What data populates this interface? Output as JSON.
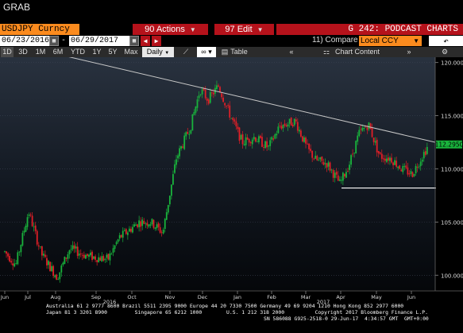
{
  "app": {
    "title": "GRAB"
  },
  "header": {
    "ticker": "USDJPY Curncy",
    "actions": "90 Actions",
    "edit": "97 Edit",
    "chart_id": "G 242: PODCAST CHARTS"
  },
  "range": {
    "start": "06/23/2016",
    "separator": "-",
    "end": "06/29/2017",
    "compare_label": "11) Compare",
    "compare_value": "Local CCY"
  },
  "toolbar": {
    "periods": [
      "1D",
      "3D",
      "1M",
      "6M",
      "YTD",
      "1Y",
      "5Y",
      "Max"
    ],
    "frequency": "Daily",
    "table": "Table",
    "chart_content": "Chart Content"
  },
  "footer": {
    "line1": "Australia 61 2 9777 8600 Brazil 5511 2395 9000 Europe 44 20 7330 7500 Germany 49 69 9204 1210 Hong Kong 852 2977 6000",
    "line2": "Japan 81 3 3201 8900         Singapore 65 6212 1000        U.S. 1 212 318 2000          Copyright 2017 Bloomberg Finance L.P.",
    "line3": "SN 586088 G925-2518-0 29-Jun-17  4:34:57 GMT  GMT+0:00"
  },
  "colors": {
    "up": "#19b33c",
    "down": "#e01f27",
    "orange": "#fb8b1e",
    "red_button": "#b5121b"
  },
  "chart_data": {
    "type": "candlestick",
    "title": "",
    "x_tick_labels": [
      "Jun",
      "Jul",
      "Aug",
      "Sep",
      "Oct",
      "Nov",
      "Dec",
      "Jan",
      "Feb",
      "Mar",
      "Apr",
      "May",
      "Jun"
    ],
    "year_labels": [
      "2016",
      "2017"
    ],
    "y_ticks": [
      100,
      105,
      110,
      115,
      120
    ],
    "ylim": [
      98.6,
      120.5
    ],
    "last_price_label": "112.2950",
    "last_price": 112.295,
    "trendline": {
      "from": [
        "Aug 2016",
        121.0
      ],
      "to": [
        "Jun 2017",
        112.5
      ]
    },
    "support_line": {
      "value": 108.2,
      "from": "Apr 2017",
      "to": "Jun 2017"
    },
    "monthly_closes": [
      {
        "month": "Jul 2016",
        "value": 102.0
      },
      {
        "month": "Aug 2016",
        "value": 101.5
      },
      {
        "month": "Sep 2016",
        "value": 101.3
      },
      {
        "month": "Oct 2016",
        "value": 104.8
      },
      {
        "month": "Nov 2016",
        "value": 114.5
      },
      {
        "month": "Dec 2016",
        "value": 117.0
      },
      {
        "month": "Jan 2017",
        "value": 113.0
      },
      {
        "month": "Feb 2017",
        "value": 112.7
      },
      {
        "month": "Mar 2017",
        "value": 111.4
      },
      {
        "month": "Apr 2017",
        "value": 111.5
      },
      {
        "month": "May 2017",
        "value": 110.8
      },
      {
        "month": "Jun 2017",
        "value": 112.3
      }
    ]
  }
}
